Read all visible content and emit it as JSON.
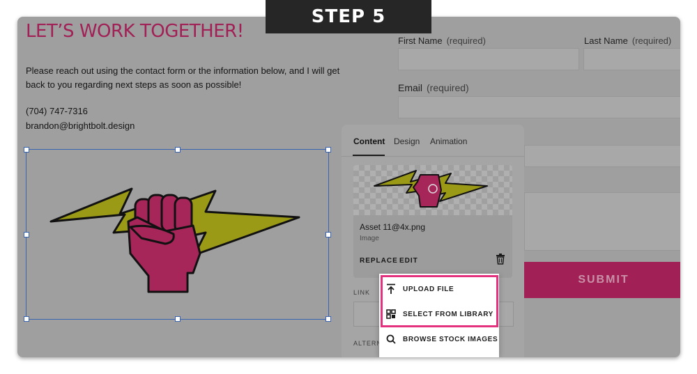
{
  "step_banner": "STEP 5",
  "page": {
    "title": "LET’S WORK TOGETHER!",
    "intro": "Please reach out using the contact form or the information below, and I will get back to you regarding next steps as soon as possible!",
    "phone": "(704) 747-7316",
    "email": "brandon@brightbolt.design"
  },
  "form": {
    "first_name_label": "First Name",
    "last_name_label": "Last Name",
    "email_label": "Email",
    "required_text": "(required)",
    "submit_label": "SUBMIT"
  },
  "panel": {
    "tabs": [
      "Content",
      "Design",
      "Animation"
    ],
    "active_tab": "Content",
    "asset_name": "Asset 11@4x.png",
    "asset_type": "Image",
    "replace_label": "REPLACE",
    "edit_label": "EDIT",
    "link_label": "LINK",
    "alt_label": "ALTERN"
  },
  "dropdown": {
    "items": [
      {
        "label": "UPLOAD FILE",
        "icon": "upload-icon"
      },
      {
        "label": "SELECT FROM LIBRARY",
        "icon": "grid-library-icon"
      },
      {
        "label": "BROWSE STOCK IMAGES",
        "icon": "search-icon"
      }
    ]
  },
  "colors": {
    "accent": "#a12056",
    "highlight": "#e3317e",
    "bolt": "#9a9a17",
    "fist": "#a6265a",
    "selection": "#3a63b0",
    "overlay_gray": "#9f9f9f"
  }
}
